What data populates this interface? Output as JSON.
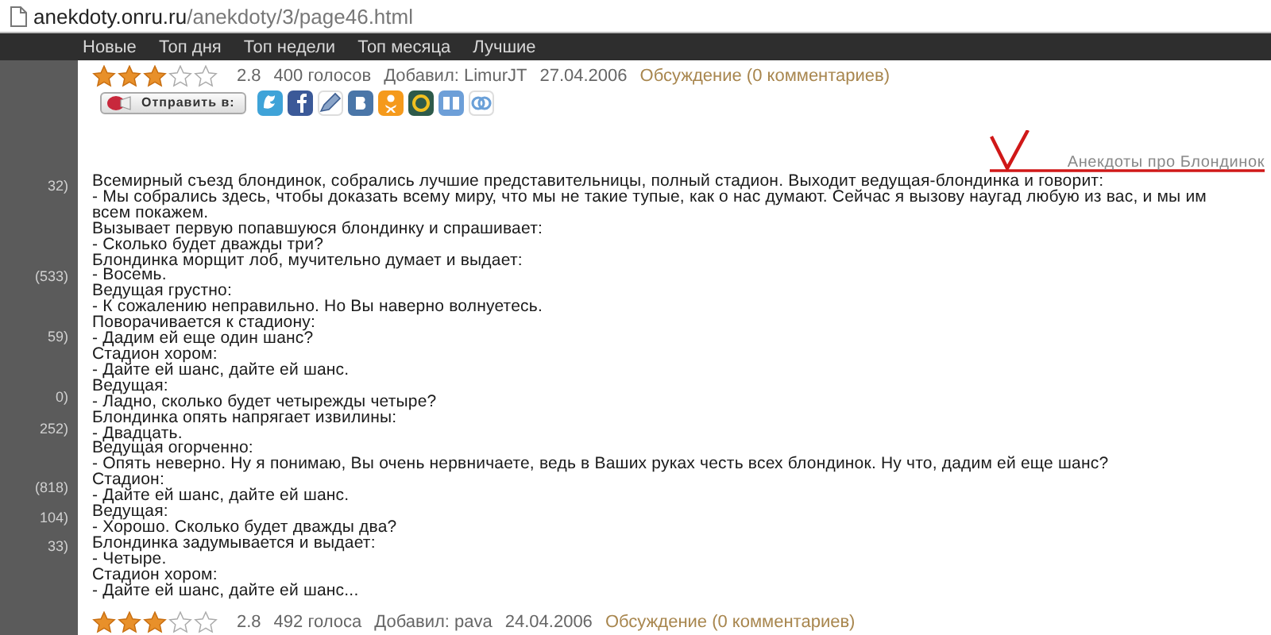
{
  "address_bar": {
    "host": "anekdoty.onru.ru",
    "path": "/anekdoty/3/page46.html"
  },
  "nav": [
    "Новые",
    "Топ дня",
    "Топ недели",
    "Топ месяца",
    "Лучшие"
  ],
  "sidebar_counts": [
    "32)",
    "(533)",
    "59)",
    "0)",
    "252)",
    "(818)",
    "104)",
    "33)"
  ],
  "top_rating": {
    "stars": 3,
    "score": "2.8",
    "votes": "400 голосов",
    "author": "Добавил: LimurJT",
    "date": "27.04.2006",
    "discussion": "Обсуждение (0 комментариев)"
  },
  "share_button": "Отправить в:",
  "category": "Анекдоты про Блондинок",
  "story_lines": [
    "Всемирный съезд блондинок, собрались лучшие представительницы, полный стадион. Выходит ведущая-блондинка и говорит:",
    "- Мы собрались здесь, чтобы доказать всему миру, что мы не такие тупые, как о нас думают. Сейчас я вызову наугад любую из вас, и мы им",
    "всем покажем.",
    "Вызывает первую попавшуюся блондинку и спрашивает:",
    "- Сколько будет дважды три?",
    "Блондинка морщит лоб, мучительно думает и выдает:",
    "- Восемь.",
    "Ведущая грустно:",
    "- К сожалению неправильно. Но Вы наверно волнуетесь.",
    "Поворачивается к стадиону:",
    "- Дадим ей еще один шанс?",
    "Стадион хором:",
    "- Дайте ей шанс, дайте ей шанс.",
    "Ведущая:",
    "- Ладно, сколько будет четырежды четыре?",
    "Блондинка опять напрягает извилины:",
    "- Двадцать.",
    "Ведущая огорченно:",
    "- Опять неверно. Ну я понимаю, Вы очень нервничаете, ведь в Ваших руках честь всех блондинок. Ну что, дадим ей еще шанс?",
    "Стадион:",
    "- Дайте ей шанс, дайте ей шанс.",
    "Ведущая:",
    "- Хорошо. Сколько будет дважды два?",
    "Блондинка задумывается и выдает:",
    "- Четыре.",
    "Стадион хором:",
    "- Дайте ей шанс, дайте ей шанс..."
  ],
  "bottom_rating": {
    "stars": 3,
    "score": "2.8",
    "votes": "492 голоса",
    "author": "Добавил: pava",
    "date": "24.04.2006",
    "discussion": "Обсуждение (0 комментариев)"
  }
}
